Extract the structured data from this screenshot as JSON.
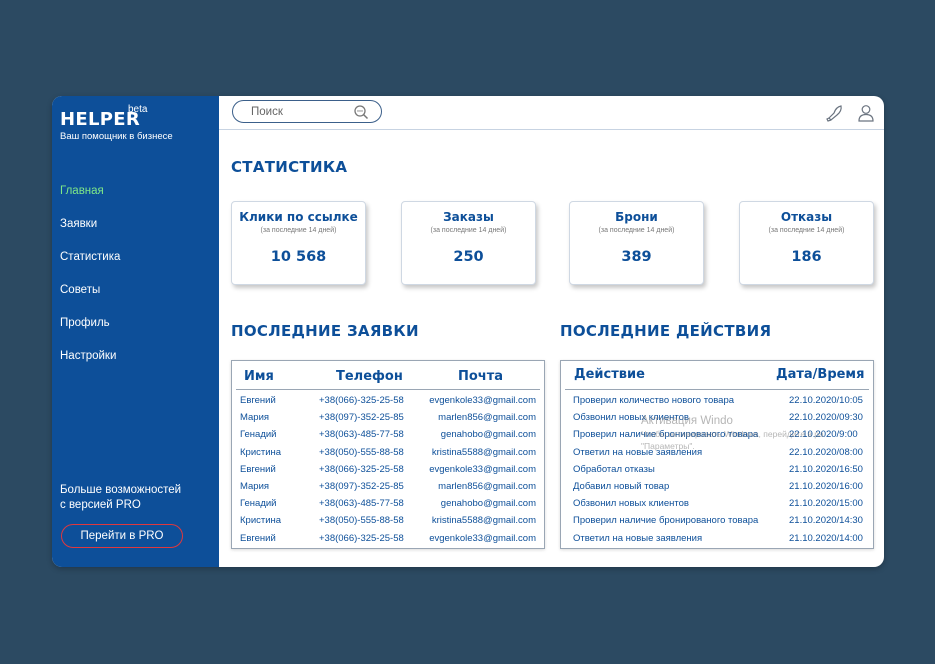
{
  "brand": {
    "name": "HELPER",
    "badge": "beta",
    "tagline": "Ваш помощник в бизнесе"
  },
  "nav": [
    {
      "label": "Главная",
      "active": true
    },
    {
      "label": "Заявки",
      "active": false
    },
    {
      "label": "Статистика",
      "active": false
    },
    {
      "label": "Советы",
      "active": false
    },
    {
      "label": "Профиль",
      "active": false
    },
    {
      "label": "Настройки",
      "active": false
    }
  ],
  "promo": {
    "text": "Больше возможностей\n с версией PRO",
    "button": "Перейти в PRO"
  },
  "search": {
    "placeholder": "Поиск"
  },
  "top_icons": [
    "notification-bell-icon",
    "user-icon"
  ],
  "stats": {
    "title": "СТАТИСТИКА",
    "cards": [
      {
        "title": "Клики по ссылке",
        "period": "(за последние 14 дней)",
        "value": "10 568"
      },
      {
        "title": "Заказы",
        "period": "(за последние 14 дней)",
        "value": "250"
      },
      {
        "title": "Брони",
        "period": "(за последние 14 дней)",
        "value": "389"
      },
      {
        "title": "Отказы",
        "period": "(за последние 14 дней)",
        "value": "186"
      }
    ]
  },
  "requests": {
    "title": "ПОСЛЕДНИЕ ЗАЯВКИ",
    "columns": [
      "Имя",
      "Телефон",
      "Почта"
    ],
    "rows": [
      [
        "Евгений",
        "+38(066)-325-25-58",
        "evgenkole33@gmail.com"
      ],
      [
        "Мария",
        "+38(097)-352-25-85",
        "marlen856@gmail.com"
      ],
      [
        "Генадий",
        "+38(063)-485-77-58",
        "genahobo@gmail.com"
      ],
      [
        "Кристина",
        "+38(050)-555-88-58",
        "kristina5588@gmail.com"
      ],
      [
        "Евгений",
        "+38(066)-325-25-58",
        "evgenkole33@gmail.com"
      ],
      [
        "Мария",
        "+38(097)-352-25-85",
        "marlen856@gmail.com"
      ],
      [
        "Генадий",
        "+38(063)-485-77-58",
        "genahobo@gmail.com"
      ],
      [
        "Кристина",
        "+38(050)-555-88-58",
        "kristina5588@gmail.com"
      ],
      [
        "Евгений",
        "+38(066)-325-25-58",
        "evgenkole33@gmail.com"
      ]
    ]
  },
  "actions": {
    "title": "ПОСЛЕДНИЕ ДЕЙСТВИЯ",
    "columns": [
      "Действие",
      "Дата/Время"
    ],
    "rows": [
      [
        "Проверил количество нового товара",
        "22.10.2020/10:05"
      ],
      [
        "Обзвонил новых клиентов",
        "22.10.2020/09:30"
      ],
      [
        "Проверил наличие бронированого товара",
        "22.10.2020/9:00"
      ],
      [
        "Ответил на новые заявления",
        "22.10.2020/08:00"
      ],
      [
        "Обработал отказы",
        "21.10.2020/16:50"
      ],
      [
        "Добавил новый товар",
        "21.10.2020/16:00"
      ],
      [
        "Обзвонил новых клиентов",
        "21.10.2020/15:00"
      ],
      [
        "Проверил наличие бронированого товара",
        "21.10.2020/14:30"
      ],
      [
        "Ответил на новые заявления",
        "21.10.2020/14:00"
      ]
    ]
  },
  "watermark": {
    "line1": "Активация Windo",
    "line2": "Чтобы активировать Windows, перейдите в ра",
    "line3": "\"Параметры\"."
  },
  "colors": {
    "primary": "#0d4f99",
    "background": "#2c4a62",
    "active_nav": "#7ee887",
    "pro_border": "#e0383d"
  }
}
